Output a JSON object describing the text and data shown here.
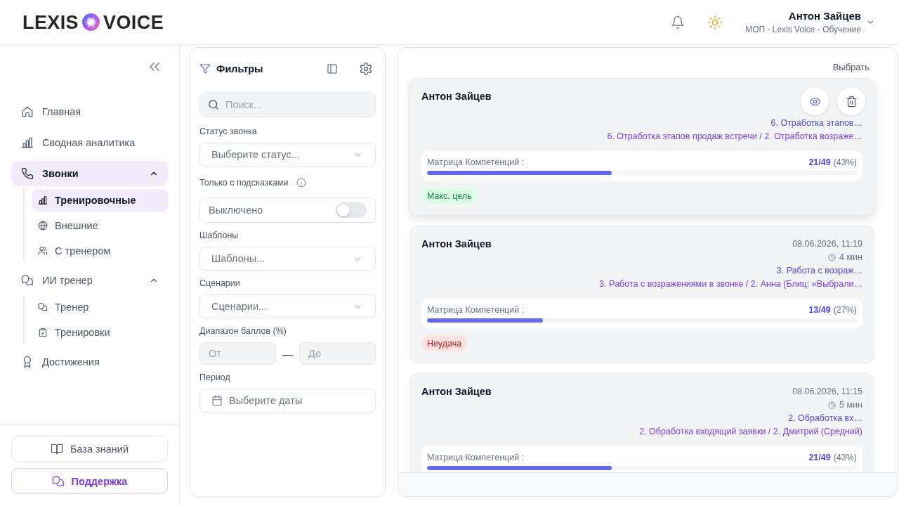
{
  "header": {
    "logo": {
      "left": "LEXIS",
      "right": "VOICE"
    },
    "user": {
      "name": "Антон Зайцев",
      "role": "МОП - Lexis Voice - Обучение"
    }
  },
  "sidebar": {
    "items": [
      {
        "label": "Главная",
        "selected": false
      },
      {
        "label": "Сводная аналитика",
        "selected": false
      },
      {
        "label": "Звонки",
        "selected": true,
        "expanded": true,
        "children": [
          {
            "label": "Тренировочные",
            "selected": true
          },
          {
            "label": "Внешние",
            "selected": false
          },
          {
            "label": "С тренером",
            "selected": false
          }
        ]
      },
      {
        "label": "ИИ тренер",
        "selected": false,
        "expanded": true,
        "children": [
          {
            "label": "Тренер",
            "selected": false
          },
          {
            "label": "Тренировки",
            "selected": false
          }
        ]
      },
      {
        "label": "Достижения",
        "selected": false
      }
    ],
    "footer_buttons": [
      {
        "label": "База знаний",
        "kind": "default"
      },
      {
        "label": "Поддержка",
        "kind": "accent"
      }
    ]
  },
  "filters": {
    "title": "Фильтры",
    "search": {
      "placeholder": "Поиск..."
    },
    "fields": [
      {
        "kind": "select",
        "label": "Статус звонка",
        "placeholder": "Выберите статус..."
      },
      {
        "kind": "toggle",
        "label": "Только с подсказками",
        "info": true,
        "status_text": "Выключено",
        "on": false
      },
      {
        "kind": "select",
        "label": "Шаблоны",
        "placeholder": "Шаблоны..."
      },
      {
        "kind": "select",
        "label": "Сценарии",
        "placeholder": "Сценарии..."
      },
      {
        "kind": "range",
        "label": "Диапазон баллов (%)",
        "from_placeholder": "От",
        "separator": "—",
        "to_placeholder": "До"
      },
      {
        "kind": "date",
        "label": "Период",
        "placeholder": "Выберите даты"
      }
    ]
  },
  "calls": {
    "select_label": "Выбрать",
    "cards": [
      {
        "name": "Антон Зайцев",
        "hovered": true,
        "scenario_short": "6. Отработка этапов…",
        "scenario_full": "6. Отработка этапов продаж встречи / 2. Отработка возраже…",
        "metric": {
          "label": "Матрица Компетенций :",
          "score": "21/49",
          "percent": "(43%)",
          "level": 0.43
        },
        "result": {
          "label": "Макс. цель",
          "kind": "success"
        }
      },
      {
        "name": "Антон Зайцев",
        "hovered": false,
        "date": "08.06.2026, 11:19",
        "duration": "4 мин",
        "scenario_short": "3. Работа с возраж…",
        "scenario_full": "3. Работа с возражениями в звонке / 2. Анна (Блиц: «Выбрали…",
        "metric": {
          "label": "Матрица Компетенций :",
          "score": "13/49",
          "percent": "(27%)",
          "level": 0.27
        },
        "result": {
          "label": "Неудача",
          "kind": "failure"
        }
      },
      {
        "name": "Антон Зайцев",
        "hovered": false,
        "date": "08.06.2026, 11:15",
        "duration": "5 мин",
        "scenario_short": "2. Обработка вх…",
        "scenario_full": "2. Обработка входящий заявки / 2. Дмитрий (Средний)",
        "metric": {
          "label": "Матрица Компетенций :",
          "score": "21/49",
          "percent": "(43%)",
          "level": 0.43
        }
      }
    ]
  }
}
